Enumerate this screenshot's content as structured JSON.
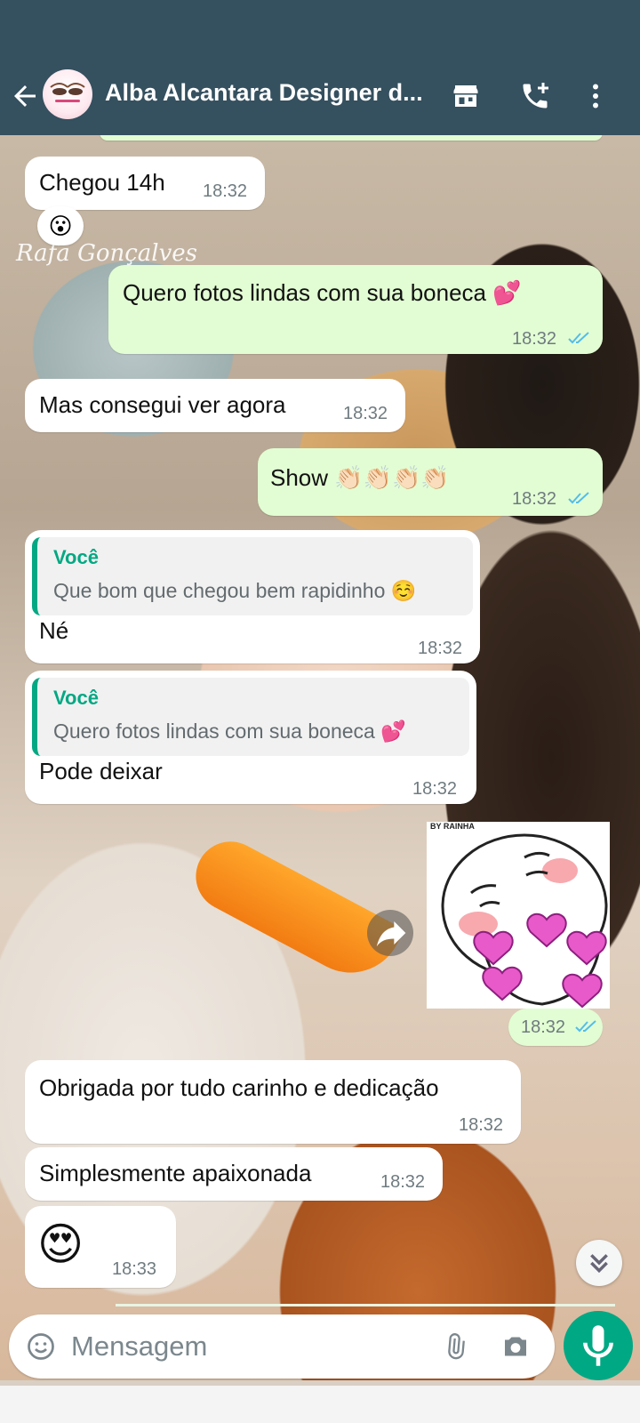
{
  "header": {
    "contact_name": "Alba Alcantara Designer d...",
    "avatar_text": "Alba Alcantara"
  },
  "wallpaper": {
    "watermark": "Rafa Gonçalves"
  },
  "messages": [
    {
      "dir": "in",
      "text": "Chegou 14h",
      "time": "18:32"
    },
    {
      "dir": "in",
      "reaction": "😮"
    },
    {
      "dir": "out",
      "text": "Quero fotos lindas com sua boneca 💕",
      "time": "18:32",
      "status": "read"
    },
    {
      "dir": "in",
      "text": "Mas consegui ver agora",
      "time": "18:32"
    },
    {
      "dir": "out",
      "text": "Show 👏🏻👏🏻👏🏻👏🏻",
      "time": "18:32",
      "status": "read"
    },
    {
      "dir": "in",
      "quote_name": "Você",
      "quote_text": "Que bom que chegou bem rapidinho ☺️",
      "text": "Né",
      "time": "18:32"
    },
    {
      "dir": "in",
      "quote_name": "Você",
      "quote_text": "Quero fotos lindas com sua boneca 💕",
      "text": "Pode deixar",
      "time": "18:32"
    },
    {
      "dir": "out",
      "type": "sticker",
      "sticker_label": "BY RAINHA",
      "time": "18:32",
      "status": "read"
    },
    {
      "dir": "in",
      "text": "Obrigada por tudo carinho e dedicação",
      "time": "18:32"
    },
    {
      "dir": "in",
      "text": "Simplesmente apaixonada",
      "time": "18:32"
    },
    {
      "dir": "in",
      "text": "😍",
      "time": "18:33"
    }
  ],
  "composer": {
    "placeholder": "Mensagem"
  },
  "colors": {
    "header": "#35505f",
    "out_bubble": "#e2fdd3",
    "in_bubble": "#ffffff",
    "accent": "#00a884",
    "read_ticks": "#53bdeb"
  },
  "icons": [
    "back-arrow-icon",
    "store-icon",
    "add-call-icon",
    "more-vertical-icon",
    "emoji-icon",
    "attach-icon",
    "camera-icon",
    "mic-icon",
    "forward-icon",
    "double-chevron-down-icon"
  ]
}
